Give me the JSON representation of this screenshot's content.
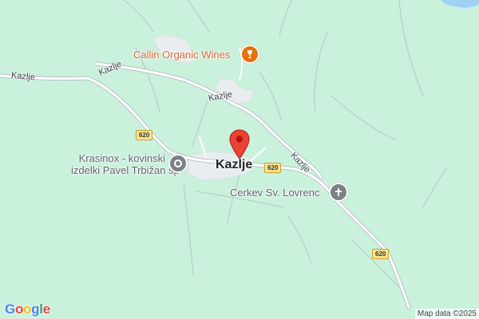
{
  "map": {
    "place_name": "Kazlje",
    "road_labels": [
      "Kazlje",
      "Kazlje",
      "Kazlje",
      "Kazlje"
    ],
    "route_shields": [
      "620",
      "620",
      "620"
    ],
    "pois": [
      {
        "name": "Callin Organic Wines",
        "icon": "wine-glass-icon",
        "color": "#e8710a"
      },
      {
        "name_line1": "Krasinox - kovinski",
        "name_line2": "izdelki Pavel Trbižan sp",
        "icon": "dot-marker-icon",
        "color": "#7b8186"
      },
      {
        "name": "Cerkev Sv. Lovrenc",
        "icon": "church-cross-icon",
        "color": "#7b8186"
      }
    ],
    "pin": {
      "icon": "location-pin-icon",
      "color": "#ea4335"
    },
    "logo_text": "Google",
    "attribution": "Map data ©2025",
    "colors": {
      "land": "#c9f1dc",
      "road": "#ffffff",
      "road_casing": "#b6c2c9",
      "built_area": "#eceff1",
      "logo_blue": "#4285f4",
      "logo_red": "#ea4335",
      "logo_yellow": "#fbbc05",
      "logo_green": "#34a853"
    }
  }
}
